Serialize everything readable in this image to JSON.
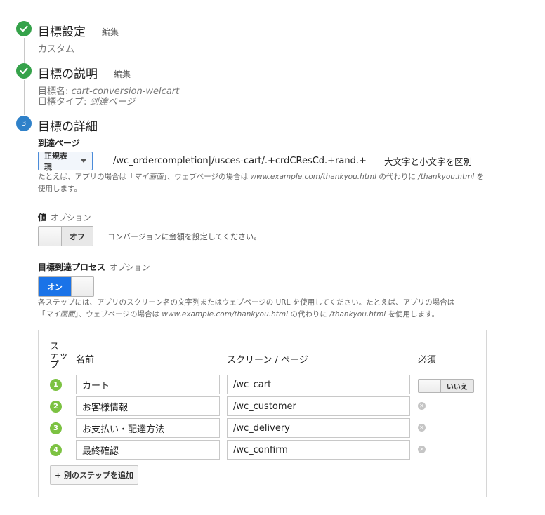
{
  "steps": {
    "goal_setup": {
      "title": "目標設定",
      "edit": "編集",
      "summary": "カスタム"
    },
    "goal_description": {
      "title": "目標の説明",
      "edit": "編集",
      "name_label": "目標名:",
      "name_value": "cart-conversion-welcart",
      "type_label": "目標タイプ:",
      "type_value": "到達ページ"
    },
    "goal_details": {
      "number": "3",
      "title": "目標の詳細"
    }
  },
  "destination": {
    "label": "到達ページ",
    "match_type": "正規表現",
    "url_value": "/wc_ordercompletion|/usces-cart/.+crdCResCd.+rand.+",
    "case_sensitive_label": "大文字と小文字を区別",
    "help_line1_a": "たとえば、アプリの場合は「",
    "help_line1_b": "マイ画面",
    "help_line1_c": "」、ウェブページの場合は",
    "help_line1_d": "www.example.com/thankyou.html",
    "help_line1_e": "の代わりに",
    "help_line1_f": "/thankyou.html",
    "help_line1_g": "を",
    "help_line2": "使用します。"
  },
  "value": {
    "label": "値",
    "optional": "オプション",
    "toggle_label": "オフ",
    "hint": "コンバージョンに金額を設定してください。"
  },
  "funnel": {
    "label": "目標到達プロセス",
    "optional": "オプション",
    "toggle_label": "オン",
    "help_line1": "各ステップには、アプリのスクリーン名の文字列またはウェブページの URL を使用してください。たとえば、アプリの場合は",
    "help_line2_a": "「",
    "help_line2_b": "マイ画面",
    "help_line2_c": "」、ウェブページの場合は",
    "help_line2_d": "www.example.com/thankyou.html",
    "help_line2_e": "の代わりに",
    "help_line2_f": "/thankyou.html",
    "help_line2_g": "を使用します。",
    "table": {
      "col_step": [
        "ス",
        "テッ",
        "プ"
      ],
      "col_name": "名前",
      "col_screen": "スクリーン / ページ",
      "col_required": "必須",
      "rows": [
        {
          "num": "1",
          "name": "カート",
          "path": "/wc_cart"
        },
        {
          "num": "2",
          "name": "お客様情報",
          "path": "/wc_customer"
        },
        {
          "num": "3",
          "name": "お支払い・配達方法",
          "path": "/wc_delivery"
        },
        {
          "num": "4",
          "name": "最終確認",
          "path": "/wc_confirm"
        }
      ],
      "required_toggle": "いいえ",
      "remove_icon": "✕",
      "add_step": "+ 別のステップを追加"
    }
  },
  "colors": {
    "done": "#35a24a",
    "current": "#2f81c9",
    "step": "#7cc242",
    "accent": "#1a73e8"
  },
  "icons": {
    "done": "check-icon",
    "remove": "remove-circle-icon"
  }
}
